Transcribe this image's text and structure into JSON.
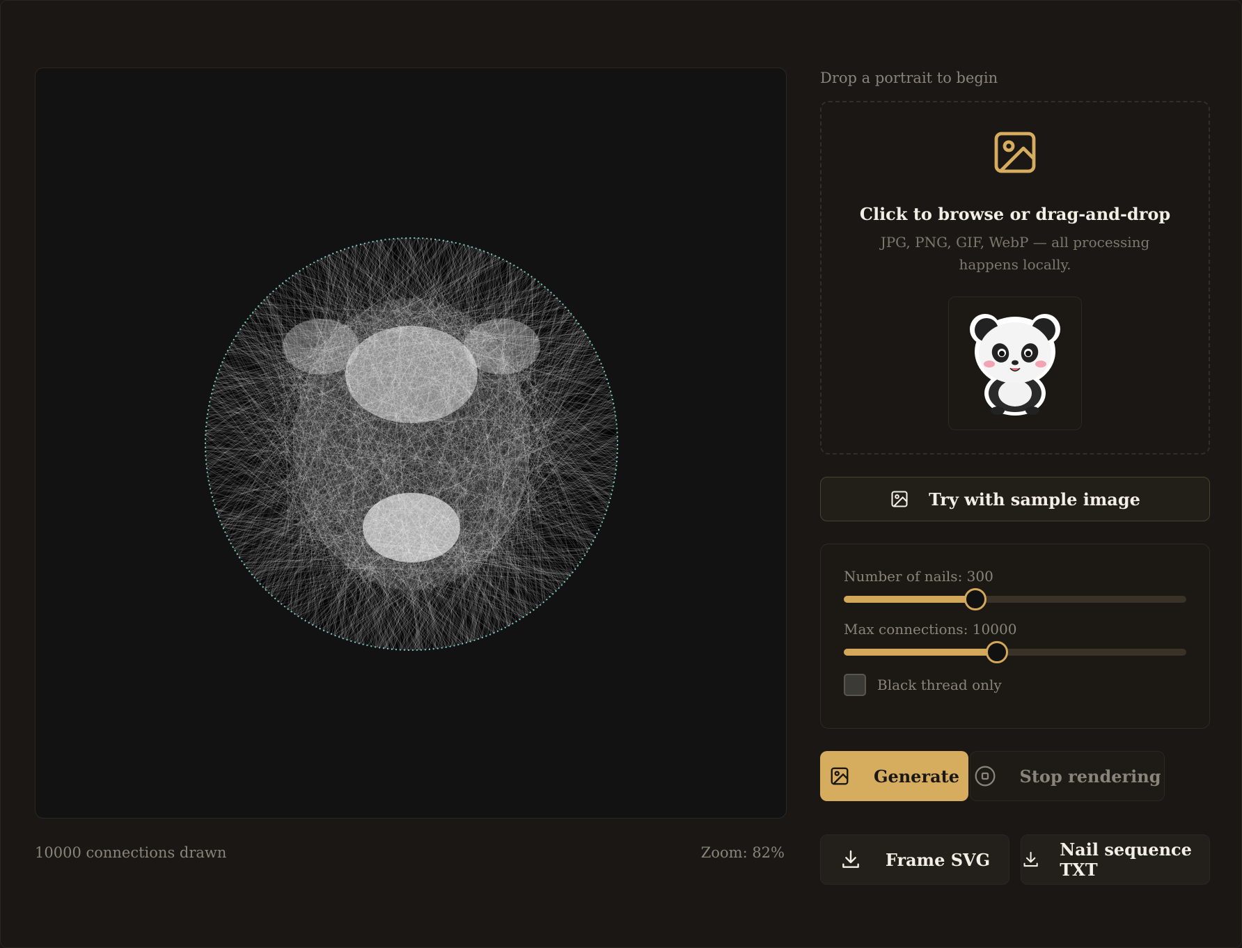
{
  "canvas": {
    "status_connections": "10000 connections drawn",
    "status_zoom": "Zoom: 82%"
  },
  "upload": {
    "heading": "Drop a portrait to begin",
    "title": "Click to browse or drag-and-drop",
    "subtitle": "JPG, PNG, GIF, WebP — all processing happens locally.",
    "icon": "image-icon",
    "thumbnail": "panda-sample-thumbnail"
  },
  "sample_button": {
    "label": "Try with sample image",
    "icon": "image-icon"
  },
  "settings": {
    "nails_label": "Number of nails: 300",
    "nails_value": 300,
    "nails_fraction": 0.384,
    "connections_label": "Max connections: 10000",
    "connections_value": 10000,
    "connections_fraction": 0.447,
    "black_thread_label": "Black thread only",
    "black_thread_checked": false
  },
  "actions": {
    "generate_label": "Generate",
    "stop_label": "Stop rendering"
  },
  "downloads": {
    "svg_label": "Frame SVG",
    "txt_label": "Nail sequence TXT"
  },
  "colors": {
    "accent": "#d6ad5f",
    "background": "#1a1714",
    "nail_ring": "#7ecfc0"
  }
}
